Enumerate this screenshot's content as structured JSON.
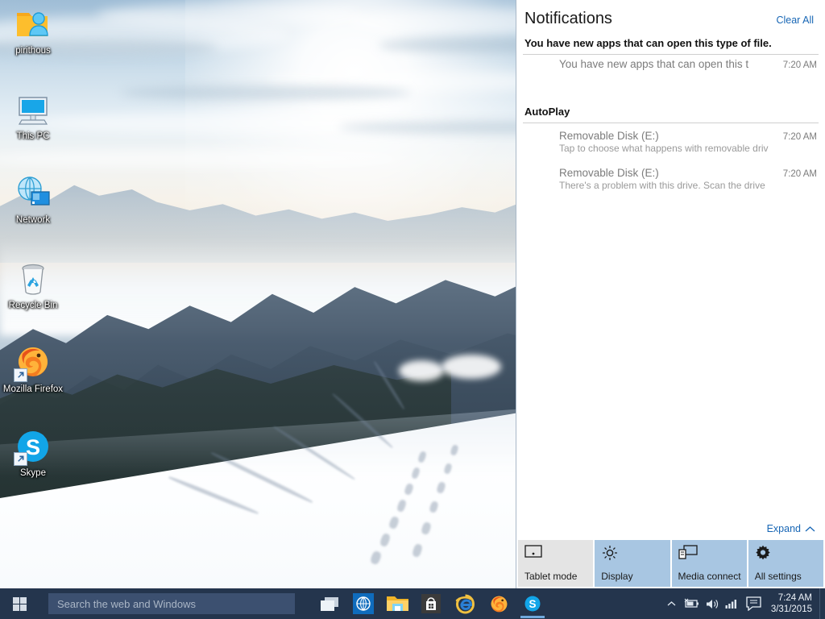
{
  "desktop": {
    "icons": [
      {
        "label": "pirithous",
        "icon": "user-folder-icon"
      },
      {
        "label": "This PC",
        "icon": "this-pc-icon"
      },
      {
        "label": "Network",
        "icon": "network-icon"
      },
      {
        "label": "Recycle Bin",
        "icon": "recycle-bin-icon"
      },
      {
        "label": "Mozilla Firefox",
        "icon": "firefox-icon"
      },
      {
        "label": "Skype",
        "icon": "skype-icon"
      }
    ]
  },
  "action_center": {
    "title": "Notifications",
    "clear_all": "Clear All",
    "groups": [
      {
        "title": "You have new apps that can open this type of file.",
        "items": [
          {
            "title": "You have new apps that can open this t",
            "sub": "",
            "time": "7:20 AM"
          }
        ]
      },
      {
        "title": "AutoPlay",
        "items": [
          {
            "title": "Removable Disk (E:)",
            "sub": "Tap to choose what happens with removable driv",
            "time": "7:20 AM"
          },
          {
            "title": "Removable Disk (E:)",
            "sub": "There's a problem with this drive.  Scan the drive",
            "time": "7:20 AM"
          }
        ]
      }
    ],
    "expand_label": "Expand",
    "quick_actions": [
      {
        "label": "Tablet mode",
        "icon": "tablet-mode-icon",
        "active": false
      },
      {
        "label": "Display",
        "icon": "brightness-icon",
        "active": true
      },
      {
        "label": "Media connect",
        "icon": "media-connect-icon",
        "active": true
      },
      {
        "label": "All settings",
        "icon": "gear-icon",
        "active": true
      }
    ],
    "colors": {
      "tile_active": "#a8c6e2",
      "tile_inactive": "#e4e4e4",
      "link": "#1766b5"
    }
  },
  "taskbar": {
    "start_label": "Start",
    "search_placeholder": "Search the web and Windows",
    "apps": [
      {
        "name": "task-view",
        "running": false
      },
      {
        "name": "edge-globe",
        "running": false
      },
      {
        "name": "file-explorer",
        "running": false
      },
      {
        "name": "store",
        "running": false
      },
      {
        "name": "internet-explorer",
        "running": false
      },
      {
        "name": "firefox",
        "running": false
      },
      {
        "name": "skype",
        "running": true
      }
    ],
    "tray": [
      {
        "name": "show-hidden-icons-icon"
      },
      {
        "name": "battery-icon"
      },
      {
        "name": "volume-icon"
      },
      {
        "name": "network-signal-icon"
      },
      {
        "name": "action-center-icon"
      }
    ],
    "clock_time": "7:24 AM",
    "clock_date": "3/31/2015",
    "colors": {
      "bar": "#24354d",
      "search": "#3c5070"
    }
  }
}
